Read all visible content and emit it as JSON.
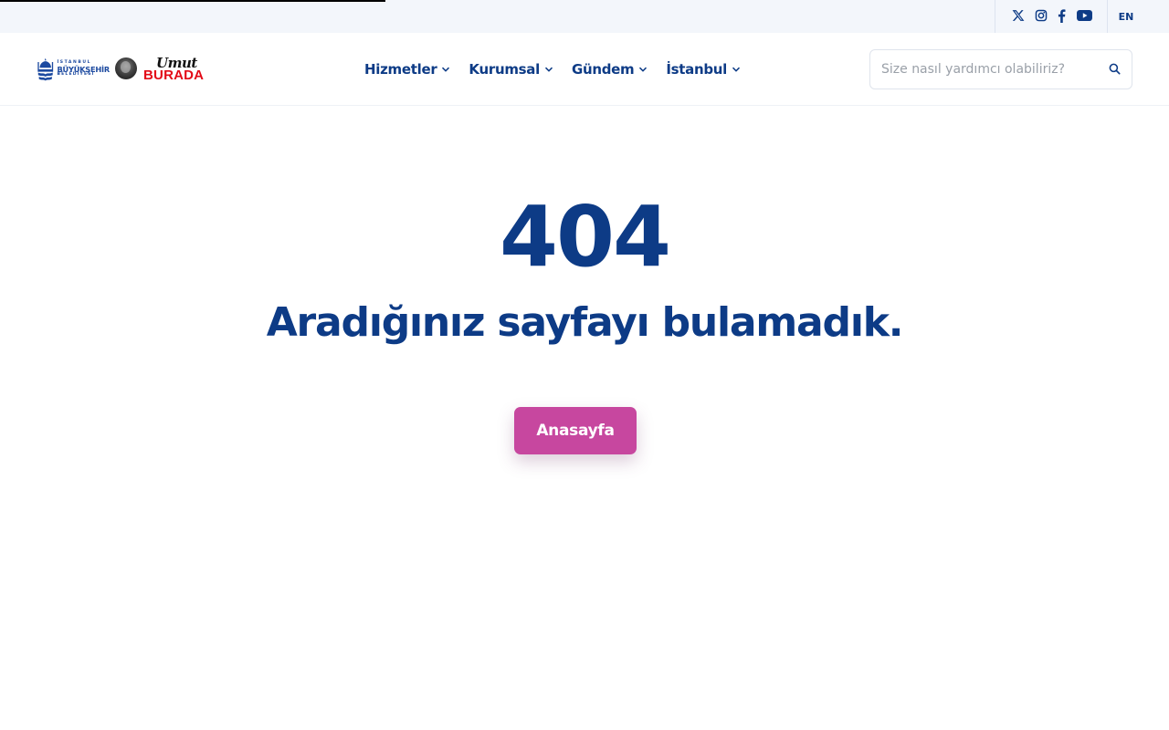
{
  "topbar": {
    "social": [
      {
        "icon": "x-twitter-icon",
        "label": "X"
      },
      {
        "icon": "instagram-icon",
        "label": "Instagram"
      },
      {
        "icon": "facebook-icon",
        "label": "Facebook"
      },
      {
        "icon": "youtube-icon",
        "label": "YouTube"
      }
    ],
    "language": "EN"
  },
  "header": {
    "logo": {
      "line1": "İSTANBUL",
      "line2": "BÜYÜKŞEHİR",
      "line3": "BELEDİYESİ"
    },
    "campaign": {
      "script": "Umut",
      "word": "BURADA"
    },
    "nav": [
      {
        "label": "Hizmetler"
      },
      {
        "label": "Kurumsal"
      },
      {
        "label": "Gündem"
      },
      {
        "label": "İstanbul"
      }
    ],
    "search": {
      "placeholder": "Size nasıl yardımcı olabiliriz?",
      "value": ""
    }
  },
  "main": {
    "code": "404",
    "message": "Aradığınız sayfayı bulamadık.",
    "button": "Anasayfa"
  },
  "colors": {
    "primary": "#0d3b86",
    "button": "#c7479f",
    "topbar_bg": "#f3f6fb",
    "campaign_red": "#e30a17"
  }
}
